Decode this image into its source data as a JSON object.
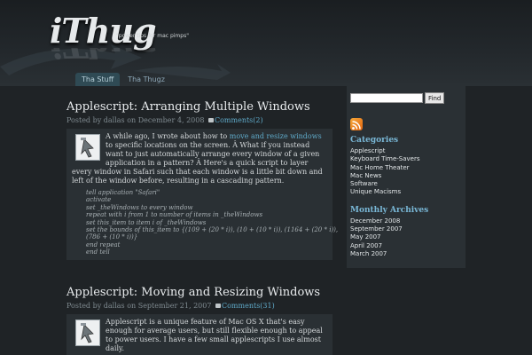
{
  "header": {
    "logo": "iThug",
    "tagline": "\"power tips for mac pimps\""
  },
  "nav": {
    "tabs": [
      {
        "label": "Tha Stuff",
        "active": true
      },
      {
        "label": "Tha Thugz",
        "active": false
      }
    ]
  },
  "posts": [
    {
      "title": "Applescript: Arranging Multiple Windows",
      "meta_prefix": "Posted by dallas on December 4, 2008",
      "comments": "Comments(2)",
      "body_before_link": "A while ago, I wrote about how to ",
      "body_link": "move and resize windows",
      "body_after_link": " to specific locations on the screen. Â What if you instead want to just automatically arrange every window of a given application in a pattern? Â Here's a quick script to layer every window in Safari such that each window is a little bit down and left of the window before, resulting in a cascading pattern.",
      "code": [
        "tell application \"Safari\"",
        "activate",
        "set _theWindows to every window",
        "repeat with i from 1 to number of items in _theWindows",
        "set this_item to item i of _theWindows",
        "set the bounds of this_item to {(109 + (20 * i)), (10 + (10 * i)), (1164 + (20 * i)),",
        "(786 + (10 * i))}",
        "end repeat",
        "end tell"
      ]
    },
    {
      "title": "Applescript: Moving and Resizing Windows",
      "meta_prefix": "Posted by dallas on September 21, 2007",
      "comments": "Comments(31)",
      "body": "Applescript is a unique feature of Mac OS X that's easy enough for average users, but still flexible enough to appeal to power users. I have a few small applescripts I use almost daily."
    }
  ],
  "sidebar": {
    "search_button": "Find",
    "search_value": "",
    "categories_heading": "Categories",
    "categories": [
      "Applescript",
      "Keyboard Time-Savers",
      "Mac Home Theater",
      "Mac News",
      "Software",
      "Unique Macisms"
    ],
    "archives_heading": "Monthly Archives",
    "archives": [
      "December 2008",
      "September 2007",
      "May 2007",
      "April 2007",
      "March 2007"
    ]
  },
  "icons": {
    "rss": "rss-feed-icon",
    "comment": "comment-bubble-icon",
    "thumb": "applescript-icon"
  },
  "colors": {
    "background": "#1f2326",
    "panel": "#2a3034",
    "link": "#5fa9c8",
    "heading": "#79b7d6",
    "active_tab": "#2f4a54"
  }
}
